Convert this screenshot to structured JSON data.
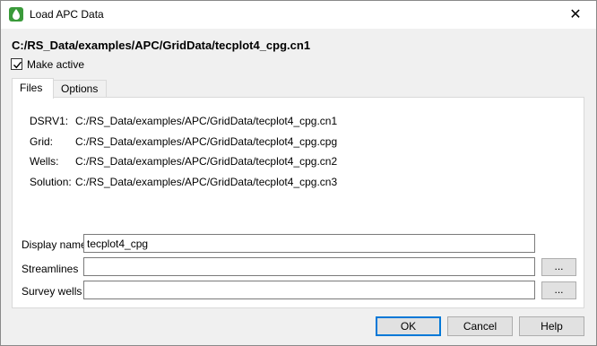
{
  "window": {
    "title": "Load APC Data",
    "close_glyph": "✕",
    "app_icon": "tecplot-droplet-icon"
  },
  "header": {
    "file_path": "C:/RS_Data/examples/APC/GridData/tecplot4_cpg.cn1",
    "make_active": {
      "label": "Make active",
      "checked": true
    }
  },
  "tabs": [
    {
      "label": "Files",
      "active": true
    },
    {
      "label": "Options",
      "active": false
    }
  ],
  "files": [
    {
      "label": "DSRV1:",
      "value": "C:/RS_Data/examples/APC/GridData/tecplot4_cpg.cn1"
    },
    {
      "label": "Grid:",
      "value": "C:/RS_Data/examples/APC/GridData/tecplot4_cpg.cpg"
    },
    {
      "label": "Wells:",
      "value": "C:/RS_Data/examples/APC/GridData/tecplot4_cpg.cn2"
    },
    {
      "label": "Solution:",
      "value": "C:/RS_Data/examples/APC/GridData/tecplot4_cpg.cn3"
    }
  ],
  "fields": {
    "display_name": {
      "label": "Display name",
      "value": "tecplot4_cpg"
    },
    "streamlines": {
      "label": "Streamlines",
      "value": "",
      "browse": "..."
    },
    "survey_wells": {
      "label": "Survey wells",
      "value": "",
      "browse": "..."
    }
  },
  "buttons": {
    "ok": "OK",
    "cancel": "Cancel",
    "help": "Help"
  },
  "colors": {
    "default_button_border": "#0078d7",
    "icon_green": "#3a9a3a"
  }
}
